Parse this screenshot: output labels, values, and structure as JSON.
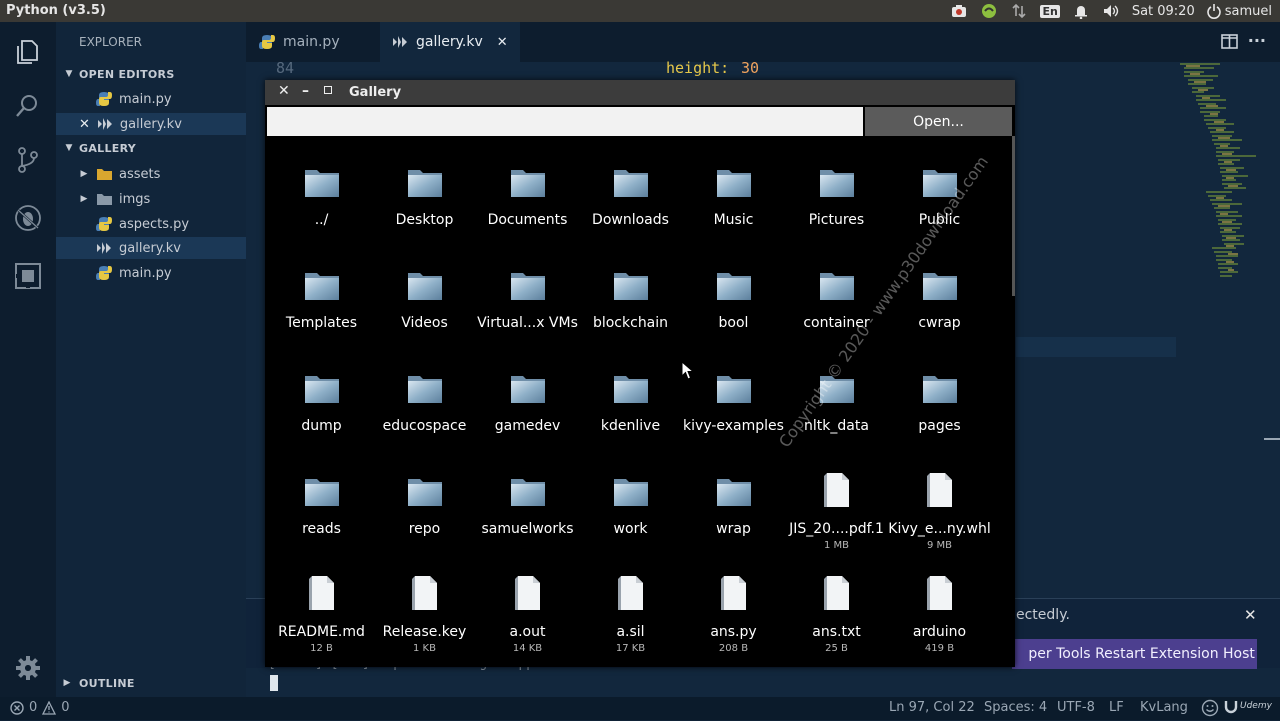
{
  "topbar": {
    "title": "Python (v3.5)",
    "lang": "En",
    "time": "Sat 09:20",
    "user": "samuel"
  },
  "sidebar": {
    "explorer": "EXPLORER",
    "open_editors": "OPEN EDITORS",
    "open_items": [
      {
        "label": "main.py"
      },
      {
        "label": "gallery.kv"
      }
    ],
    "project": "GALLERY",
    "tree": [
      {
        "label": "assets"
      },
      {
        "label": "imgs"
      },
      {
        "label": "aspects.py"
      },
      {
        "label": "gallery.kv"
      },
      {
        "label": "main.py"
      }
    ],
    "outline": "OUTLINE"
  },
  "tabs": [
    {
      "label": "main.py"
    },
    {
      "label": "gallery.kv"
    }
  ],
  "editor": {
    "line_number": "84",
    "code_key": "height:",
    "code_value": "30",
    "terminal_text": "[INFO   ] [GL          ] Unpack subimage support is availab"
  },
  "notification": {
    "message_tail": "ectedly.",
    "dev_tools_label": "per Tools",
    "restart_label": "Restart Extension Host"
  },
  "status": {
    "errors": "0",
    "warnings": "0",
    "position": "Ln 97, Col 22",
    "spaces": "Spaces: 4",
    "encoding": "UTF-8",
    "eol": "LF",
    "language": "KvLang",
    "brand": "Udemy"
  },
  "gallery": {
    "title": "Gallery",
    "path_value": "",
    "open_label": "Open...",
    "items": [
      {
        "name": "../",
        "kind": "folder",
        "size": ""
      },
      {
        "name": "Desktop",
        "kind": "folder",
        "size": ""
      },
      {
        "name": "Documents",
        "kind": "folder",
        "size": ""
      },
      {
        "name": "Downloads",
        "kind": "folder",
        "size": ""
      },
      {
        "name": "Music",
        "kind": "folder",
        "size": ""
      },
      {
        "name": "Pictures",
        "kind": "folder",
        "size": ""
      },
      {
        "name": "Public",
        "kind": "folder",
        "size": ""
      },
      {
        "name": "Templates",
        "kind": "folder",
        "size": ""
      },
      {
        "name": "Videos",
        "kind": "folder",
        "size": ""
      },
      {
        "name": "Virtual...x VMs",
        "kind": "folder",
        "size": ""
      },
      {
        "name": "blockchain",
        "kind": "folder",
        "size": ""
      },
      {
        "name": "bool",
        "kind": "folder",
        "size": ""
      },
      {
        "name": "container",
        "kind": "folder",
        "size": ""
      },
      {
        "name": "cwrap",
        "kind": "folder",
        "size": ""
      },
      {
        "name": "dump",
        "kind": "folder",
        "size": ""
      },
      {
        "name": "educospace",
        "kind": "folder",
        "size": ""
      },
      {
        "name": "gamedev",
        "kind": "folder",
        "size": ""
      },
      {
        "name": "kdenlive",
        "kind": "folder",
        "size": ""
      },
      {
        "name": "kivy-examples",
        "kind": "folder",
        "size": ""
      },
      {
        "name": "nltk_data",
        "kind": "folder",
        "size": ""
      },
      {
        "name": "pages",
        "kind": "folder",
        "size": ""
      },
      {
        "name": "reads",
        "kind": "folder",
        "size": ""
      },
      {
        "name": "repo",
        "kind": "folder",
        "size": ""
      },
      {
        "name": "samuelworks",
        "kind": "folder",
        "size": ""
      },
      {
        "name": "work",
        "kind": "folder",
        "size": ""
      },
      {
        "name": "wrap",
        "kind": "folder",
        "size": ""
      },
      {
        "name": "JIS_20....pdf.1",
        "kind": "file",
        "size": "1 MB"
      },
      {
        "name": "Kivy_e...ny.whl",
        "kind": "file",
        "size": "9 MB"
      },
      {
        "name": "README.md",
        "kind": "file",
        "size": "12 B"
      },
      {
        "name": "Release.key",
        "kind": "file",
        "size": "1 KB"
      },
      {
        "name": "a.out",
        "kind": "file",
        "size": "14 KB"
      },
      {
        "name": "a.sil",
        "kind": "file",
        "size": "17 KB"
      },
      {
        "name": "ans.py",
        "kind": "file",
        "size": "208 B"
      },
      {
        "name": "ans.txt",
        "kind": "file",
        "size": "25 B"
      },
      {
        "name": "arduino",
        "kind": "file",
        "size": "419 B"
      }
    ],
    "watermark": "Copyright © 2020 - www.p30download.com"
  },
  "colors": {
    "editor_bg": "#12273d",
    "accent_button": "#4c3f8f",
    "gallery_bg": "#000000",
    "kv_orange": "#f0a35e",
    "kv_yellow": "#e6c84a"
  }
}
